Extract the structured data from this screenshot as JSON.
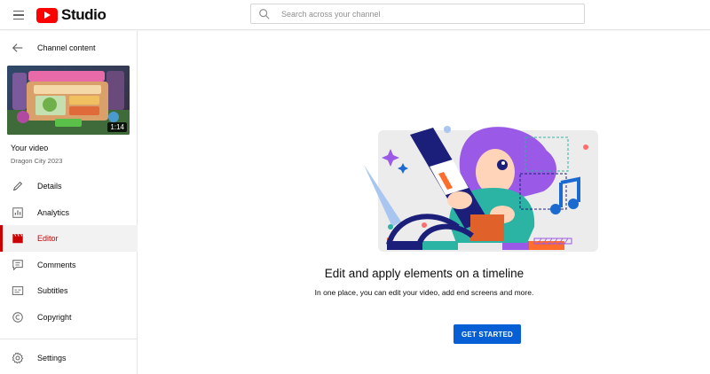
{
  "header": {
    "logo_text": "Studio",
    "search_placeholder": "Search across your channel"
  },
  "sidebar": {
    "back_label": "Channel content",
    "video": {
      "duration": "1:14",
      "title_label": "Your video",
      "name": "Dragon City 2023"
    },
    "items": [
      {
        "label": "Details",
        "icon": "pencil-icon",
        "active": false
      },
      {
        "label": "Analytics",
        "icon": "bar-chart-icon",
        "active": false
      },
      {
        "label": "Editor",
        "icon": "film-clapper-icon",
        "active": true
      },
      {
        "label": "Comments",
        "icon": "comment-icon",
        "active": false
      },
      {
        "label": "Subtitles",
        "icon": "subtitles-icon",
        "active": false
      },
      {
        "label": "Copyright",
        "icon": "copyright-icon",
        "active": false
      }
    ],
    "settings_label": "Settings"
  },
  "main": {
    "headline": "Edit and apply elements on a timeline",
    "subline": "In one place, you can edit your video, add end screens and more.",
    "cta_label": "GET STARTED"
  },
  "colors": {
    "brand_red": "#ff0000",
    "active_red": "#cc0000",
    "cta_blue": "#065fd4",
    "illustration_purple": "#9b59e8",
    "illustration_navy": "#1b1f7a",
    "illustration_teal": "#2bb3a3",
    "illustration_orange": "#ff6d2e"
  }
}
